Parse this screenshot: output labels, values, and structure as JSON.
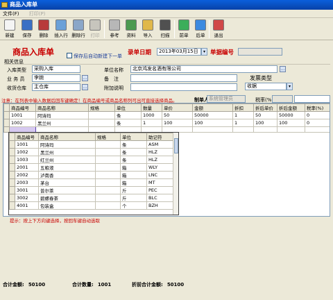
{
  "window": {
    "title": "商品入库单"
  },
  "menu": {
    "file": "文件(F)",
    "print": "打印(P)"
  },
  "toolbar": [
    {
      "label": "新建",
      "icon": "new-doc-icon",
      "color": "#f4f4f4",
      "dim": false
    },
    {
      "label": "保存",
      "icon": "save-icon",
      "color": "#3a6fc4",
      "dim": false
    },
    {
      "label": "删除",
      "icon": "delete-icon",
      "color": "#b83a3a",
      "dim": false
    },
    {
      "label": "插入行",
      "icon": "insert-row-icon",
      "color": "#6aa0d8",
      "dim": false
    },
    {
      "label": "删除行",
      "icon": "delete-row-icon",
      "color": "#8aa6c8",
      "dim": false
    },
    {
      "label": "打印",
      "icon": "print-icon",
      "color": "#c7c5bd",
      "dim": true
    },
    {
      "label": "参考",
      "icon": "reference-icon",
      "color": "#b7b7b7",
      "dim": false
    },
    {
      "label": "资料",
      "icon": "data-icon",
      "color": "#4c9a50",
      "dim": false
    },
    {
      "label": "导入",
      "icon": "import-icon",
      "color": "#e0b84a",
      "dim": false
    },
    {
      "label": "扫描",
      "icon": "barcode-icon",
      "color": "#505050",
      "dim": false
    },
    {
      "label": "前单",
      "icon": "prev-record-icon",
      "color": "#3cae5a",
      "dim": false
    },
    {
      "label": "后单",
      "icon": "next-record-icon",
      "color": "#3c8ae0",
      "dim": false
    },
    {
      "label": "退出",
      "icon": "exit-icon",
      "color": "#d04848",
      "dim": false
    }
  ],
  "header": {
    "form_title": "商品入库单",
    "auto_new_label": "保存后自动新建下一单",
    "date_label": "录单日期",
    "date_value": "2013年03月15日",
    "docno_label": "单据编号",
    "docno_value": ""
  },
  "info": {
    "group_label": "相关信息",
    "type_label": "入库类型",
    "type_value": "采购入库",
    "clerk_label": "业 务 员",
    "clerk_value": "李婉",
    "warehouse_label": "收货仓库",
    "warehouse_value": "主仓库",
    "unit_label": "单位名称",
    "unit_value": "北京鸿发名酒有限公司",
    "remark_label": "备　注",
    "remark_value": "",
    "extra_label": "附加说明",
    "extra_value": "",
    "invoice_label": "发票类型",
    "invoice_value": "收据",
    "tax_label": "税率(%)",
    "tax_value": "",
    "maker_label": "制单人",
    "maker_value": "系统管理员"
  },
  "notice": "注意：在列表中输入数据后回车键确定！在商品编号或商品名称列可出可直接选择商品。",
  "main_table": {
    "columns": [
      "商品编号",
      "商品名称",
      "规格",
      "单位",
      "数量",
      "单价",
      "金额",
      "折扣",
      "折后单价",
      "折后金额",
      "税率(%)"
    ],
    "rows": [
      [
        "1001",
        "阿诗玛",
        "",
        "条",
        "1000",
        "50",
        "50000",
        "1",
        "50",
        "50000",
        "0"
      ],
      [
        "1002",
        "黑兰州",
        "",
        "条",
        "1",
        "100",
        "100",
        "1",
        "100",
        "100",
        "0"
      ],
      [
        "",
        "",
        "",
        "",
        "",
        "",
        "",
        "",
        "",
        "",
        ""
      ]
    ]
  },
  "popup_table": {
    "columns": [
      "商品编号",
      "商品名称",
      "规格",
      "单位",
      "助记符"
    ],
    "rows": [
      [
        "1001",
        "阿诗玛",
        "",
        "条",
        "ASM"
      ],
      [
        "1002",
        "黑兰州",
        "",
        "条",
        "HLZ"
      ],
      [
        "1003",
        "红兰州",
        "",
        "条",
        "HLZ"
      ],
      [
        "2001",
        "五粮液",
        "",
        "箱",
        "WLY"
      ],
      [
        "2002",
        "泸南香",
        "",
        "箱",
        "LNC"
      ],
      [
        "2003",
        "茅台",
        "",
        "箱",
        "MT"
      ],
      [
        "3001",
        "普尔茶",
        "",
        "斤",
        "PEC"
      ],
      [
        "3002",
        "碧螺春茶",
        "",
        "斤",
        "BLC"
      ],
      [
        "4001",
        "包装盒",
        "",
        "个",
        "BZH"
      ]
    ]
  },
  "hint": "提示：按上下方向键选择，按回车键自动选取",
  "footer": {
    "total_amount_label": "合计金额:",
    "total_amount": "50100",
    "total_qty_label": "合计数量:",
    "total_qty": "1001",
    "before_discount_label": "折前合计金额:",
    "before_discount": "50100"
  },
  "colors": {
    "title_red": "#c80000",
    "titlebar_blue": "#0a5fdc",
    "window_bg": "#ece9d8"
  }
}
